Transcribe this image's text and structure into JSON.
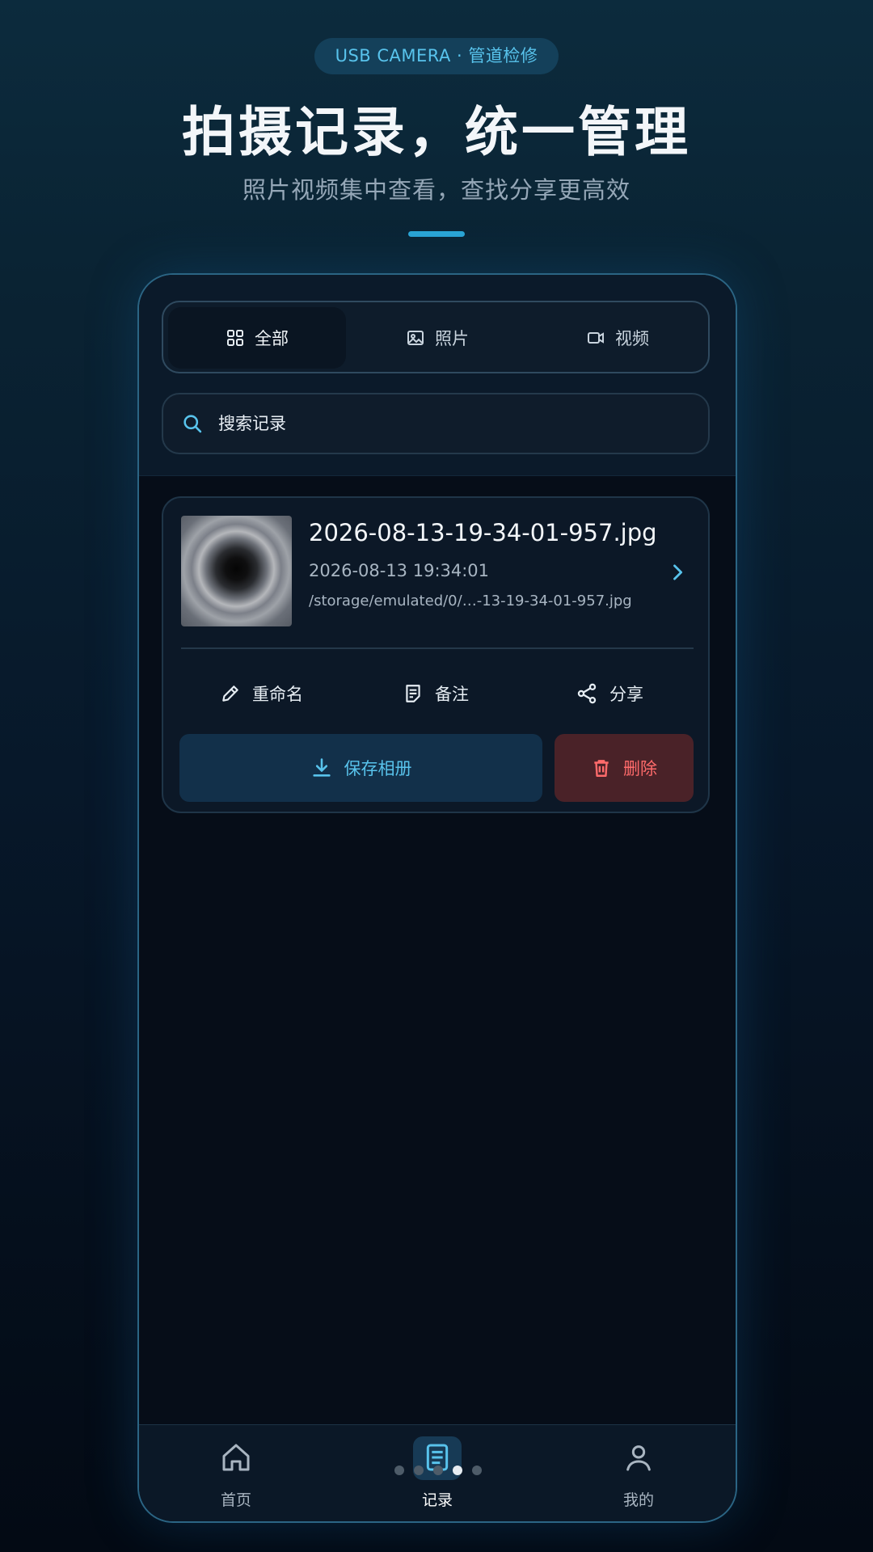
{
  "promo": {
    "badge": "USB CAMERA ·  管道检修",
    "title": "拍摄记录，统一管理",
    "subtitle": "照片视频集中查看，查找分享更高效"
  },
  "filter_tabs": [
    {
      "label": "全部",
      "icon": "grid-icon",
      "active": true
    },
    {
      "label": "照片",
      "icon": "image-icon",
      "active": false
    },
    {
      "label": "视频",
      "icon": "video-icon",
      "active": false
    }
  ],
  "search": {
    "placeholder": "搜索记录"
  },
  "records": [
    {
      "file_name": "2026-08-13-19-34-01-957.jpg",
      "date": "2026-08-13 19:34:01",
      "path": "/storage/emulated/0/…-13-19-34-01-957.jpg",
      "actions": {
        "rename": "重命名",
        "note": "备注",
        "share": "分享",
        "save": "保存相册",
        "delete": "删除"
      }
    }
  ],
  "bottom_nav": [
    {
      "label": "首页",
      "icon": "home-icon",
      "active": false
    },
    {
      "label": "记录",
      "icon": "records-icon",
      "active": true
    },
    {
      "label": "我的",
      "icon": "profile-icon",
      "active": false
    }
  ],
  "colors": {
    "accent": "#58c3ec",
    "danger": "#ff6b6b",
    "background": "#060d18"
  }
}
